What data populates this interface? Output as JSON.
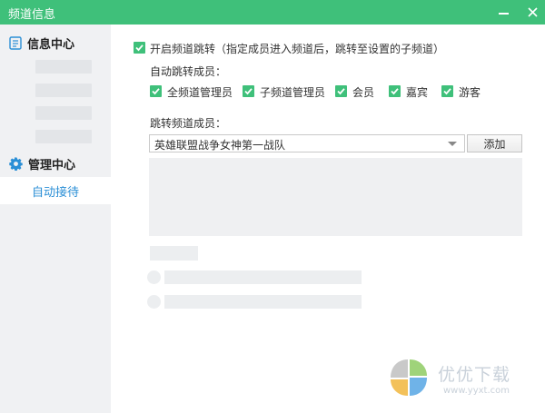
{
  "window": {
    "title": "频道信息",
    "minimize_icon": "minimize-icon",
    "close_icon": "close-icon",
    "accent_color": "#3fc07a"
  },
  "sidebar": {
    "info_center": {
      "label": "信息中心",
      "icon": "document-icon"
    },
    "manage_center": {
      "label": "管理中心",
      "icon": "gear-icon"
    },
    "active_item": {
      "label": "自动接待",
      "color": "#2b8fd6"
    }
  },
  "main": {
    "enable_jump": {
      "checked": true,
      "label": "开启频道跳转（指定成员进入频道后，跳转至设置的子频道）"
    },
    "auto_members": {
      "label": "自动跳转成员：",
      "options": [
        {
          "label": "全频道管理员",
          "checked": true
        },
        {
          "label": "子频道管理员",
          "checked": true
        },
        {
          "label": "会员",
          "checked": true
        },
        {
          "label": "嘉宾",
          "checked": true
        },
        {
          "label": "游客",
          "checked": true
        }
      ]
    },
    "jump_members": {
      "label": "跳转频道成员：",
      "selected": "英雄联盟战争女神第一战队",
      "add_button": "添加"
    }
  },
  "watermark": {
    "text": "优优下载",
    "url": "www.yyxt.com"
  }
}
